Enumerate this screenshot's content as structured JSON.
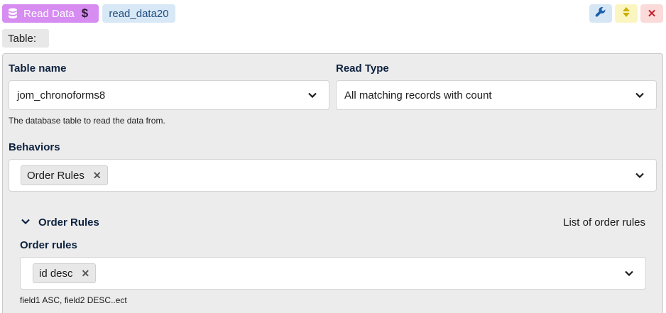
{
  "header": {
    "action_label": "Read Data",
    "action_icon": "database-icon",
    "action_secondary_icon": "dollar-icon",
    "action_secondary_glyph": "$",
    "instance_name": "read_data20",
    "edit_icon": "wrench-icon",
    "sort_icon": "sort-icon",
    "close_icon": "close-icon",
    "close_glyph": "✕"
  },
  "table_chip": "Table:",
  "form": {
    "table_name": {
      "label": "Table name",
      "value": "jom_chronoforms8",
      "hint": "The database table to read the data from."
    },
    "read_type": {
      "label": "Read Type",
      "value": "All matching records with count"
    },
    "behaviors": {
      "label": "Behaviors",
      "tags": [
        "Order Rules"
      ]
    },
    "order_rules_section": {
      "title": "Order Rules",
      "note": "List of order rules",
      "field_label": "Order rules",
      "tags": [
        "id desc"
      ],
      "hint": "field1 ASC, field2 DESC..ect"
    }
  },
  "colors": {
    "action_badge": "#d68cf0",
    "instance_badge": "#d9e8f6",
    "edit_btn": "#d6e6f5",
    "sort_btn": "#fbf6c1",
    "close_btn": "#fbdada",
    "label_text": "#0e2240",
    "panel_bg": "#ececec"
  }
}
